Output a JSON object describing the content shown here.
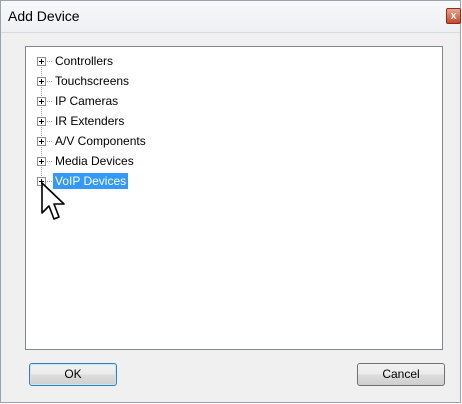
{
  "dialog": {
    "title": "Add Device",
    "close_label": "x"
  },
  "tree": {
    "items": [
      {
        "label": "Controllers",
        "selected": false
      },
      {
        "label": "Touchscreens",
        "selected": false
      },
      {
        "label": "IP Cameras",
        "selected": false
      },
      {
        "label": "IR Extenders",
        "selected": false
      },
      {
        "label": "A/V Components",
        "selected": false
      },
      {
        "label": "Media Devices",
        "selected": false
      },
      {
        "label": "VoIP Devices",
        "selected": true
      }
    ]
  },
  "buttons": {
    "ok_label": "OK",
    "cancel_label": "Cancel"
  },
  "colors": {
    "selection": "#3399ff",
    "close_button": "#c8472b"
  },
  "icons": {
    "expander": "plus-box-icon",
    "close": "close-icon",
    "pointer": "mouse-pointer-icon"
  }
}
